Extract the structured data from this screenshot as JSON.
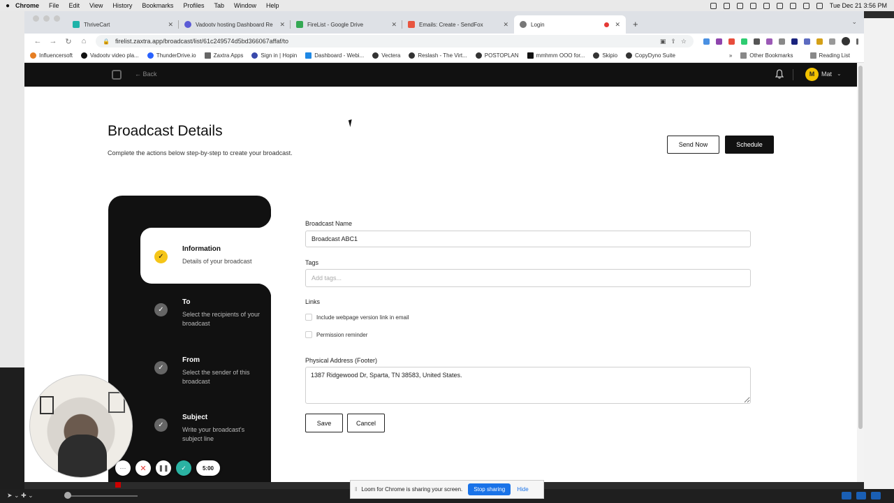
{
  "menubar": {
    "app": "Chrome",
    "items": [
      "File",
      "Edit",
      "View",
      "History",
      "Bookmarks",
      "Profiles",
      "Tab",
      "Window",
      "Help"
    ],
    "clock": "Tue Dec 21  3:56 PM"
  },
  "browser": {
    "tabs": [
      {
        "label": "ThriveCart",
        "color": "#1db3a8"
      },
      {
        "label": "Vadootv hosting Dashboard Re",
        "color": "#5b5bd6"
      },
      {
        "label": "FireList - Google Drive",
        "color": "#34a853"
      },
      {
        "label": "Emails: Create - SendFox",
        "color": "#e8553f"
      },
      {
        "label": "Login",
        "color": "#777777"
      }
    ],
    "url": "firelist.zaxtra.app/broadcast/list/61c249574d5bd366067affaf/to",
    "bookmarks": [
      "Influencersoft",
      "Vadootv video pla...",
      "ThunderDrive.io",
      "Zaxtra Apps",
      "Sign in | Hopin",
      "Dashboard - Webi...",
      "Vectera",
      "Reslash - The Virt...",
      "POSTOPLAN",
      "mmhmm OOO for...",
      "Skipio",
      "CopyDyno Suite"
    ],
    "bookmarks_more": "»",
    "other_bookmarks": "Other Bookmarks",
    "reading_list": "Reading List"
  },
  "app": {
    "back": "Back",
    "user_initial": "M",
    "user_name": "Mat"
  },
  "page": {
    "title": "Broadcast Details",
    "subtitle": "Complete the actions below step-by-step to create your broadcast.",
    "send_now": "Send Now",
    "schedule": "Schedule"
  },
  "steps": [
    {
      "name": "Information",
      "desc": "Details of your broadcast"
    },
    {
      "name": "To",
      "desc": "Select the recipients of your broadcast"
    },
    {
      "name": "From",
      "desc": "Select the sender of this broadcast"
    },
    {
      "name": "Subject",
      "desc": "Write your broadcast's subject line"
    }
  ],
  "form": {
    "name_label": "Broadcast Name",
    "name_value": "Broadcast ABC1",
    "tags_label": "Tags",
    "tags_placeholder": "Add tags...",
    "links_label": "Links",
    "link_opt1": "Include webpage version link in email",
    "link_opt2": "Permission reminder",
    "address_label": "Physical Address (Footer)",
    "address_value": "1387 Ridgewood Dr, Sparta, TN 38583, United States.",
    "save": "Save",
    "cancel": "Cancel"
  },
  "loom": {
    "timer": "5:00",
    "share_text": "Loom for Chrome is sharing your screen.",
    "stop": "Stop sharing",
    "hide": "Hide"
  }
}
